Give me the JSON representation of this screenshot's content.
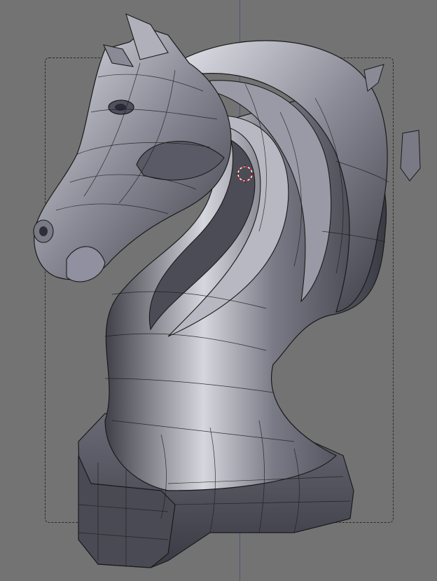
{
  "viewport": {
    "background_color": "#737373",
    "axis_color": "#4a4a8a",
    "frame_color": "#2a2a2a",
    "mesh_fill_color": "#5e5e6a",
    "mesh_highlight_color": "#c8c8d0",
    "wire_color": "#1a1a1a",
    "cursor_color": "#d22"
  },
  "model": {
    "icon": "horse-head-mesh-icon"
  },
  "cursor": {
    "icon": "3d-cursor-icon"
  }
}
